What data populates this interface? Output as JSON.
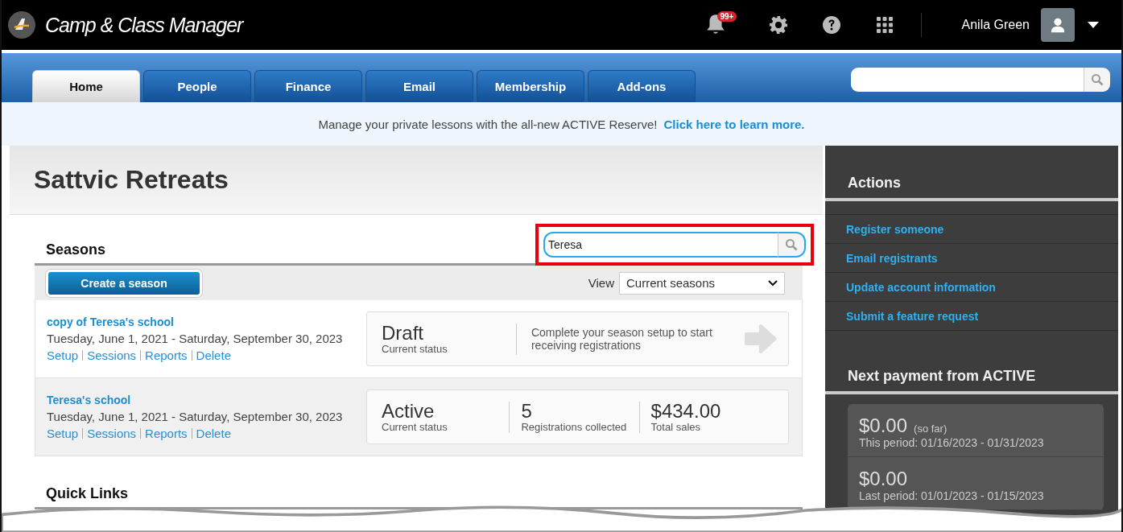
{
  "app": {
    "title": "Camp & Class Manager",
    "notification_count": "99+",
    "user_name": "Anila Green"
  },
  "tabs": [
    {
      "label": "Home",
      "selected": true
    },
    {
      "label": "People",
      "selected": false
    },
    {
      "label": "Finance",
      "selected": false
    },
    {
      "label": "Email",
      "selected": false
    },
    {
      "label": "Membership",
      "selected": false
    },
    {
      "label": "Add-ons",
      "selected": false
    }
  ],
  "banner": {
    "text": "Manage your private lessons with the all-new ACTIVE Reserve!",
    "link": "Click here to learn more."
  },
  "page_title": "Sattvic Retreats",
  "seasons": {
    "heading": "Seasons",
    "search_value": "Teresa",
    "create_button": "Create a season",
    "view_label": "View",
    "view_value": "Current seasons",
    "items": [
      {
        "kind": "draft",
        "name": "copy of Teresa's school",
        "dates": "Tuesday, June 1, 2021 - Saturday, September 30, 2023",
        "links": [
          "Setup",
          "Sessions",
          "Reports",
          "Delete"
        ],
        "status": "Draft",
        "status_label": "Current status",
        "message": "Complete your season setup to start receiving registrations"
      },
      {
        "kind": "active",
        "name": "Teresa's school",
        "dates": "Tuesday, June 1, 2021 - Saturday, September 30, 2023",
        "links": [
          "Setup",
          "Sessions",
          "Reports",
          "Delete"
        ],
        "status": "Active",
        "status_label": "Current status",
        "registrations": "5",
        "registrations_label": "Registrations collected",
        "sales": "$434.00",
        "sales_label": "Total sales"
      }
    ]
  },
  "quick_links": {
    "heading": "Quick Links"
  },
  "actions": {
    "heading": "Actions",
    "items": [
      "Register someone",
      "Email registrants",
      "Update account information",
      "Submit a feature request"
    ]
  },
  "payment": {
    "heading": "Next payment from ACTIVE",
    "periods": [
      {
        "amount": "$0.00",
        "note": "(so far)",
        "period": "This period: 01/16/2023 - 01/31/2023"
      },
      {
        "amount": "$0.00",
        "period": "Last period: 01/01/2023 - 01/15/2023"
      }
    ]
  }
}
